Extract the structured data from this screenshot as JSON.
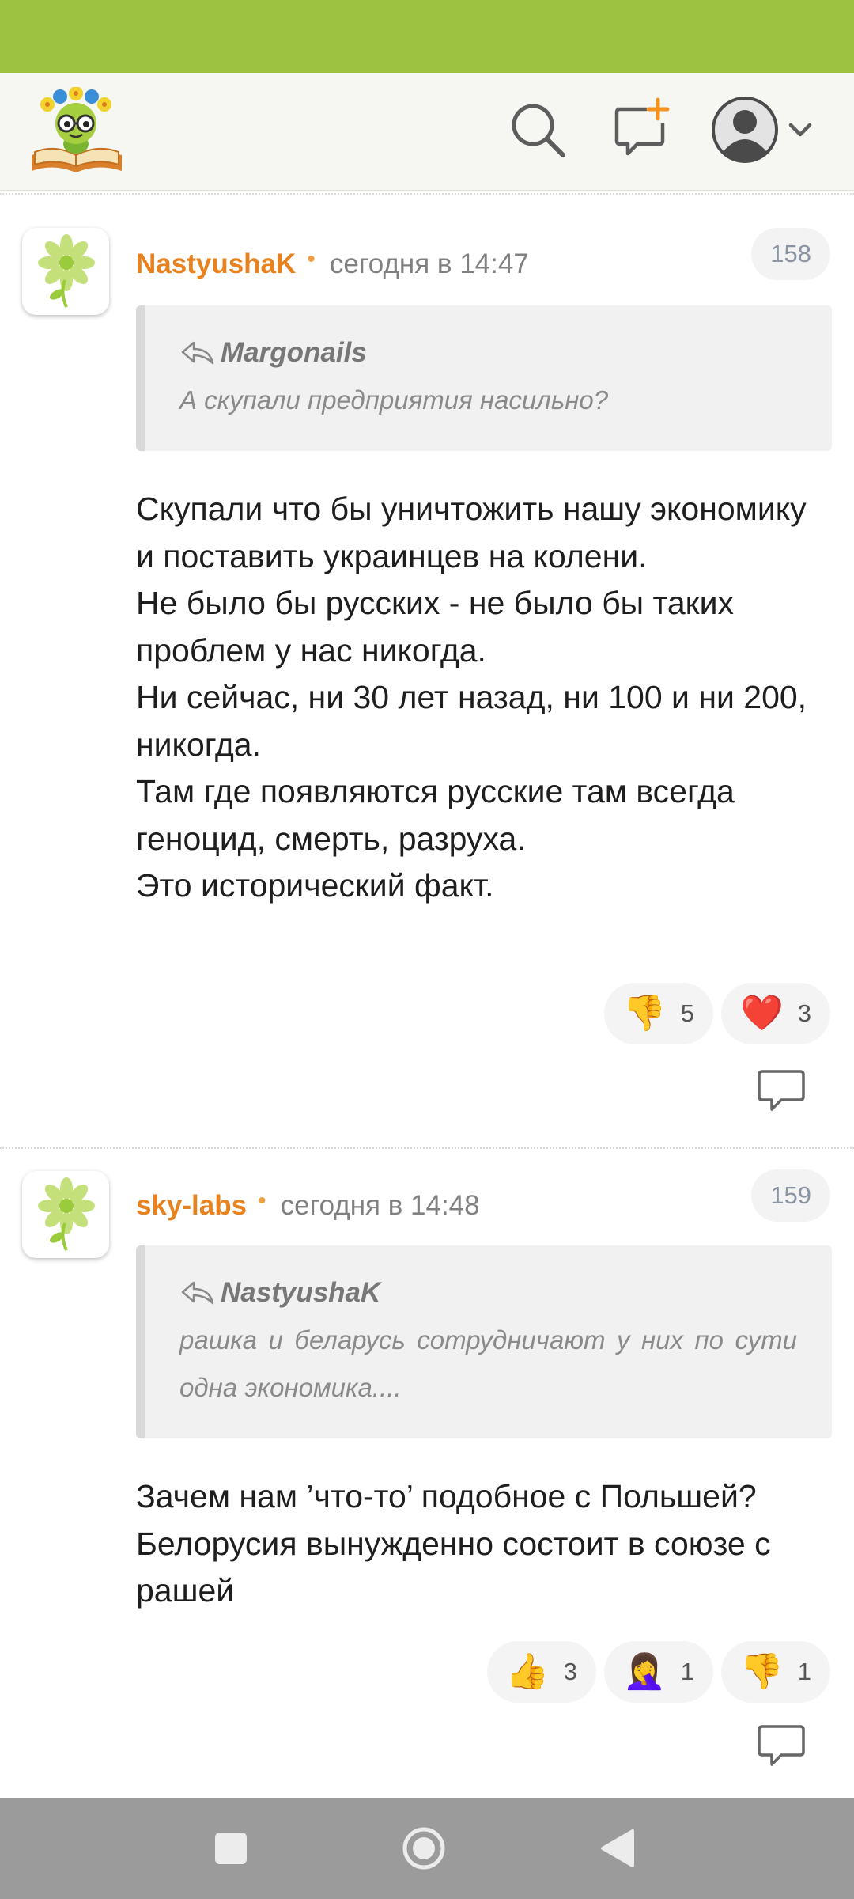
{
  "header": {
    "logo_icon": "reading-bookworm-logo-icon",
    "search_icon": "search-icon",
    "compose_icon": "new-message-icon",
    "profile_icon": "user-avatar-icon",
    "menu_icon": "chevron-down-icon"
  },
  "colors": {
    "status_bar": "#9dc241",
    "author": "#e8821e",
    "nav_bar": "#9b9b9b"
  },
  "comments": [
    {
      "author": "NastyushaK",
      "separator": "•",
      "time": "сегодня в 14:47",
      "number": "158",
      "quote": {
        "author": "Margonails",
        "text": "А скупали предприятия насильно?"
      },
      "body": [
        "Скупали что бы уничтожить нашу экономику и поставить украинцев на колени.",
        "Не было бы русских - не было бы таких проблем у нас никогда.",
        "Ни сейчас, ни 30 лет назад, ни 100 и ни 200, никогда.",
        "Там где появляются русские там всегда геноцид, смерть, разруха.",
        "Это исторический факт."
      ],
      "reactions": [
        {
          "emoji": "👎",
          "count": "5",
          "icon": "thumbs-down-icon"
        },
        {
          "emoji": "❤️",
          "count": "3",
          "icon": "heart-icon"
        }
      ]
    },
    {
      "author": "sky-labs",
      "separator": "•",
      "time": "сегодня в 14:48",
      "number": "159",
      "quote": {
        "author": "NastyushaK",
        "text": "рашка и беларусь сотрудничают у них по сути одна экономика...."
      },
      "body": [
        "Зачем нам ’что-то’ подобное с Польшей?",
        "Белорусия вынужденно состоит в союзе с рашей"
      ],
      "reactions": [
        {
          "emoji": "👍",
          "count": "3",
          "icon": "thumbs-up-icon"
        },
        {
          "emoji": "🤦‍♀️",
          "count": "1",
          "icon": "facepalm-icon"
        },
        {
          "emoji": "👎",
          "count": "1",
          "icon": "thumbs-down-icon"
        }
      ]
    }
  ],
  "navigation": {
    "recents_icon": "square-recents-icon",
    "home_icon": "circle-home-icon",
    "back_icon": "triangle-back-icon"
  }
}
